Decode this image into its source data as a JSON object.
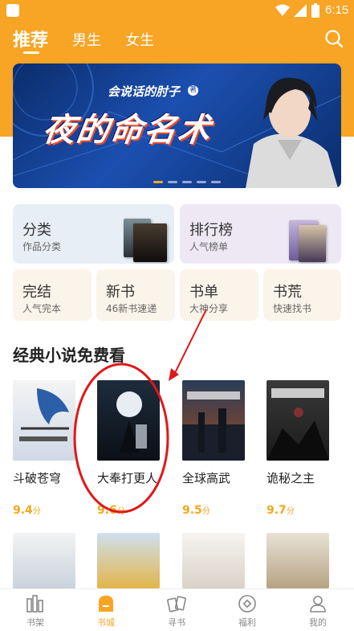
{
  "status_bar": {
    "time": "6:15"
  },
  "header": {
    "tabs": [
      {
        "label": "推荐",
        "active": true
      },
      {
        "label": "男生",
        "active": false
      },
      {
        "label": "女生",
        "active": false
      }
    ],
    "search_icon": "search-icon"
  },
  "banner": {
    "author": "会说话的肘子",
    "badge": "著",
    "title": "夜的命名术",
    "page_indicator": {
      "count": 5,
      "active": 0
    }
  },
  "categories": {
    "large": [
      {
        "title": "分类",
        "subtitle": "作品分类"
      },
      {
        "title": "排行榜",
        "subtitle": "人气榜单"
      }
    ],
    "small": [
      {
        "title": "完结",
        "subtitle": "人气完本"
      },
      {
        "title": "新书",
        "subtitle": "46新书速递"
      },
      {
        "title": "书单",
        "subtitle": "大神分享"
      },
      {
        "title": "书荒",
        "subtitle": "快速找书"
      }
    ]
  },
  "section": {
    "title": "经典小说免费看",
    "books": [
      {
        "title": "斗破苍穹",
        "score": "9.4",
        "unit": "分"
      },
      {
        "title": "大奉打更人",
        "score": "9.6",
        "unit": "分"
      },
      {
        "title": "全球高武",
        "score": "9.5",
        "unit": "分"
      },
      {
        "title": "诡秘之主",
        "score": "9.7",
        "unit": "分"
      }
    ]
  },
  "bottom_nav": [
    {
      "label": "书架",
      "icon": "bookshelf-icon",
      "active": false
    },
    {
      "label": "书城",
      "icon": "bookstore-icon",
      "active": true
    },
    {
      "label": "寻书",
      "icon": "find-book-icon",
      "active": false
    },
    {
      "label": "福利",
      "icon": "welfare-icon",
      "active": false
    },
    {
      "label": "我的",
      "icon": "profile-icon",
      "active": false
    }
  ],
  "colors": {
    "accent": "#F8A424",
    "score": "#F2A81B",
    "annotation": "#E01818"
  }
}
